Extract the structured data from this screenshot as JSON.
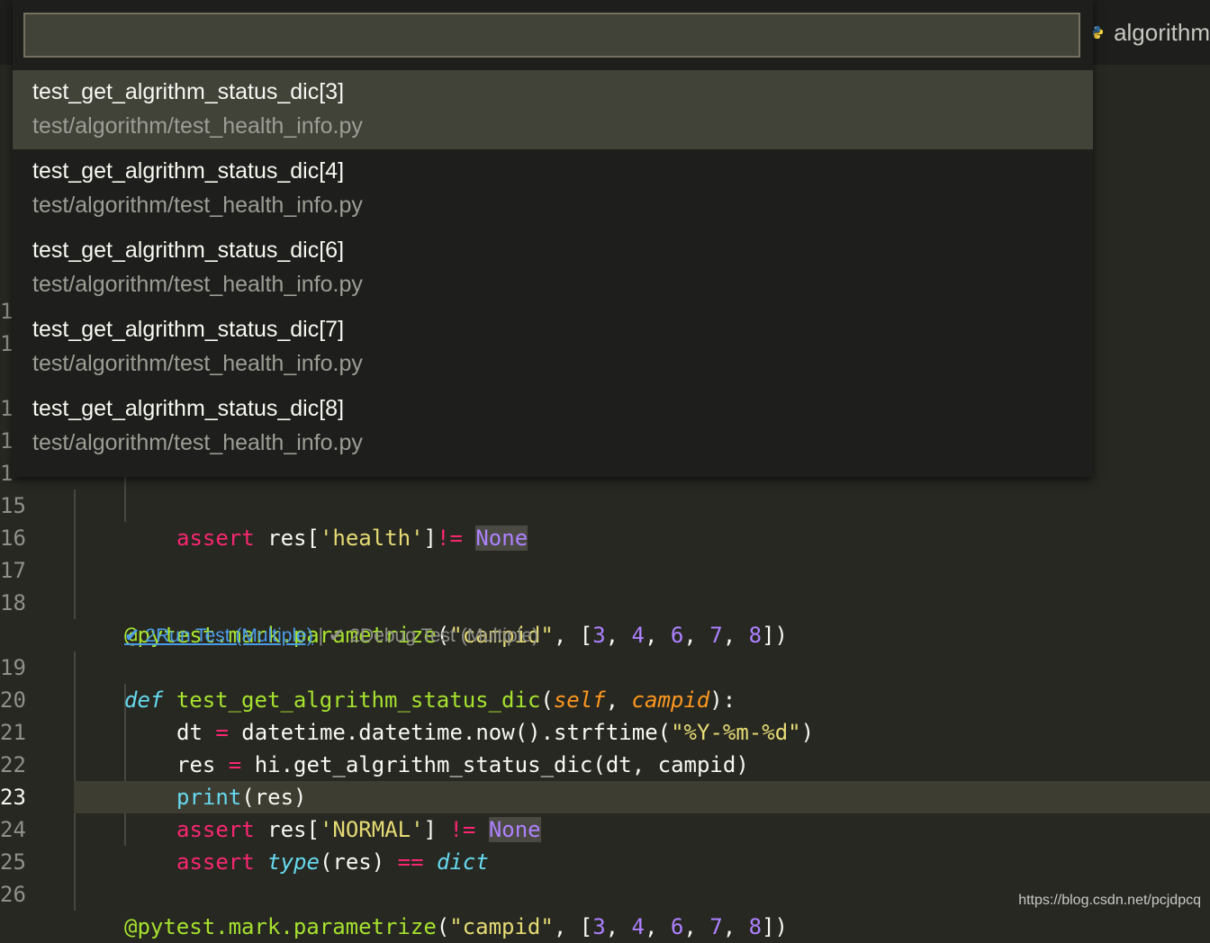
{
  "tab": {
    "label": "algorithm",
    "icon": "python-icon"
  },
  "quickpick": {
    "placeholder": "",
    "items": [
      {
        "label": "test_get_algrithm_status_dic[3]",
        "description": "test/algorithm/test_health_info.py",
        "selected": true
      },
      {
        "label": "test_get_algrithm_status_dic[4]",
        "description": "test/algorithm/test_health_info.py"
      },
      {
        "label": "test_get_algrithm_status_dic[6]",
        "description": "test/algorithm/test_health_info.py"
      },
      {
        "label": "test_get_algrithm_status_dic[7]",
        "description": "test/algorithm/test_health_info.py"
      },
      {
        "label": "test_get_algrithm_status_dic[8]",
        "description": "test/algorithm/test_health_info.py"
      }
    ]
  },
  "hidden_line_digits": [
    "1",
    "1",
    "1",
    "1",
    "1"
  ],
  "gutter": [
    "15",
    "16",
    "17",
    "18",
    "19",
    "20",
    "21",
    "22",
    "23",
    "24",
    "25",
    "26"
  ],
  "current_line": "23",
  "code": {
    "l15": {
      "kw": "assert",
      "a": " res[",
      "str": "'health'",
      "b": "]",
      "op": "!=",
      "c": " ",
      "none": "None"
    },
    "l18": {
      "dec": "@pytest.mark.parametrize",
      "p1": "(",
      "str": "\"campid\"",
      "p2": ", [",
      "n1": "3",
      "n2": "4",
      "n3": "6",
      "n4": "7",
      "n5": "8",
      "p3": "])"
    },
    "l19": {
      "def": "def",
      "name": "test_get_algrithm_status_dic",
      "p1": "(",
      "self": "self",
      "comma": ", ",
      "campid": "campid",
      "p2": "):"
    },
    "l20": {
      "a": "dt ",
      "op": "=",
      "b": " datetime.datetime.now().strftime(",
      "str": "\"%Y-%m-%d\"",
      "c": ")"
    },
    "l21": {
      "a": "res ",
      "op": "=",
      "b": " hi.get_algrithm_status_dic(dt, campid)"
    },
    "l22": {
      "print": "print",
      "b": "(res)"
    },
    "l23": {
      "kw": "assert",
      "a": " res[",
      "str": "'NORMAL'",
      "b": "] ",
      "op": "!=",
      "c": " ",
      "none": "None"
    },
    "l24": {
      "kw": "assert",
      "a": " ",
      "type": "type",
      "b": "(res) ",
      "op": "==",
      "c": " ",
      "dict": "dict"
    },
    "l26": {
      "dec": "@pytest.mark.parametrize",
      "p1": "(",
      "str": "\"campid\"",
      "p2": ", [",
      "n1": "3",
      "n2": "4",
      "n3": "6",
      "n4": "7",
      "n5": "8",
      "p3": "])"
    }
  },
  "codelens": {
    "run_label": "✔ 2Run Test (Multiple)",
    "separator": " | ",
    "debug_label": "✔ 2Debug Test (Multiple)"
  },
  "watermark": "https://blog.csdn.net/pcjdpcq",
  "colors": {
    "background": "#272822",
    "keyword": "#f92672",
    "function": "#a6e22e",
    "string": "#e6db74",
    "number": "#ae81ff",
    "link": "#4b9ce8"
  }
}
